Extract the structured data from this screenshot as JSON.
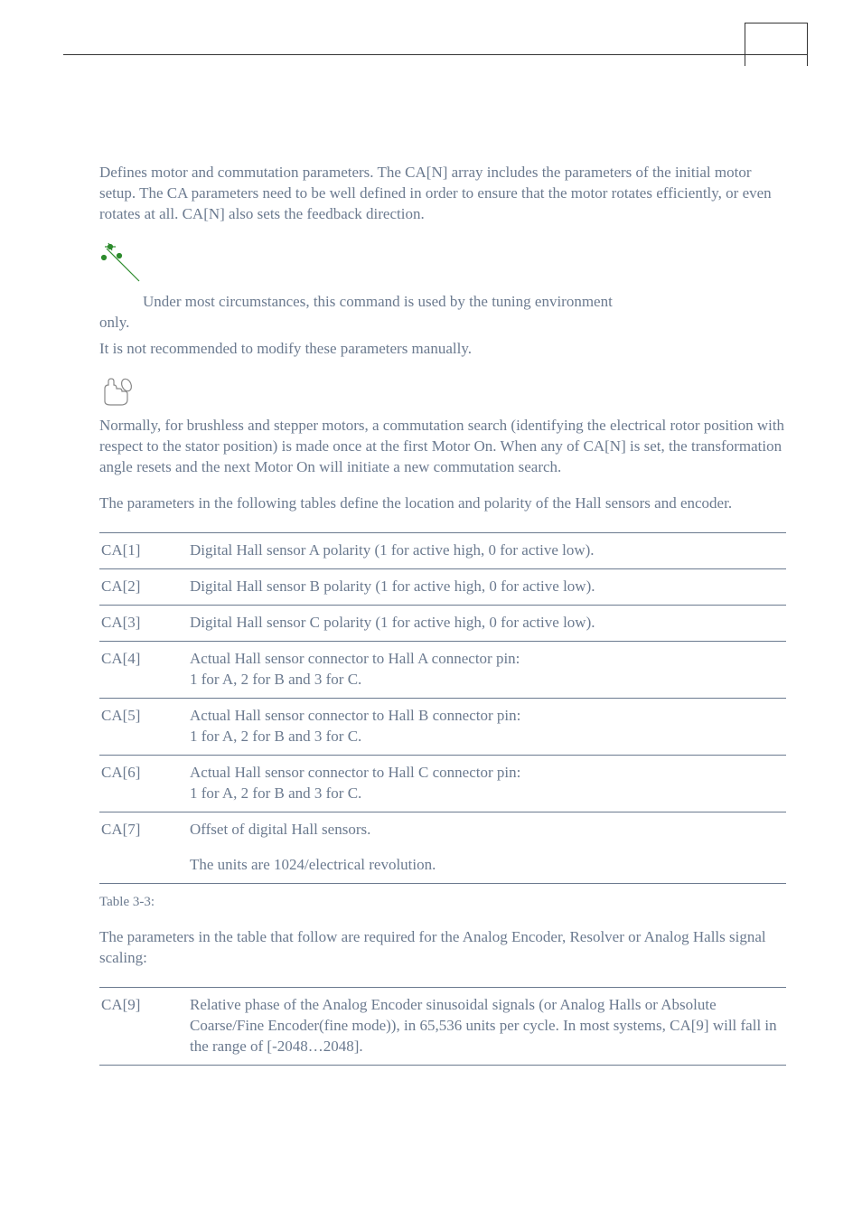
{
  "intro": {
    "p1": "Defines motor and commutation parameters. The CA[N] array includes the parameters of the initial motor setup. The CA parameters need to be well defined in order to ensure that the motor rotates efficiently, or even rotates at all. CA[N] also sets the feedback direction.",
    "note1_line1": "Under most circumstances, this command is used by the tuning environment",
    "note1_line2": "only.",
    "note1_tail": "It is not recommended to modify these parameters manually.",
    "p2": "Normally, for brushless and stepper motors, a commutation search (identifying the electrical rotor position with respect to the stator position) is made once at the first Motor On. When any of CA[N] is set, the transformation angle resets and the next Motor On will initiate a new commutation search.",
    "p3": "The parameters in the following tables define the location and polarity of the Hall sensors and encoder."
  },
  "table1": {
    "rows": [
      {
        "key": "CA[1]",
        "desc": "Digital Hall sensor A polarity (1 for active high, 0 for active low)."
      },
      {
        "key": "CA[2]",
        "desc": "Digital Hall sensor B polarity (1 for active high, 0 for active low)."
      },
      {
        "key": "CA[3]",
        "desc": "Digital Hall sensor C polarity (1 for active high, 0 for active low)."
      },
      {
        "key": "CA[4]",
        "desc": "Actual Hall sensor connector to Hall A connector pin:\n1 for A, 2 for B and 3 for C."
      },
      {
        "key": "CA[5]",
        "desc": "Actual Hall sensor connector to Hall B connector pin:\n1 for A, 2 for B and 3 for C."
      },
      {
        "key": "CA[6]",
        "desc": "Actual Hall sensor connector to Hall C connector pin:\n1 for A, 2 for B and 3 for C."
      },
      {
        "key": "CA[7]",
        "desc": "Offset of digital Hall sensors.",
        "desc2": "The units are 1024/electrical revolution."
      }
    ],
    "caption": "Table 3-3:"
  },
  "mid": {
    "p4": "The parameters in the table that follow are required for the Analog Encoder, Resolver or Analog Halls signal scaling:"
  },
  "table2": {
    "rows": [
      {
        "key": "CA[9]",
        "desc": "Relative phase of the Analog Encoder sinusoidal signals (or Analog Halls or Absolute Coarse/Fine Encoder(fine mode)), in 65,536 units per cycle. In most systems, CA[9] will fall in the range of [-2048…2048]."
      }
    ]
  }
}
